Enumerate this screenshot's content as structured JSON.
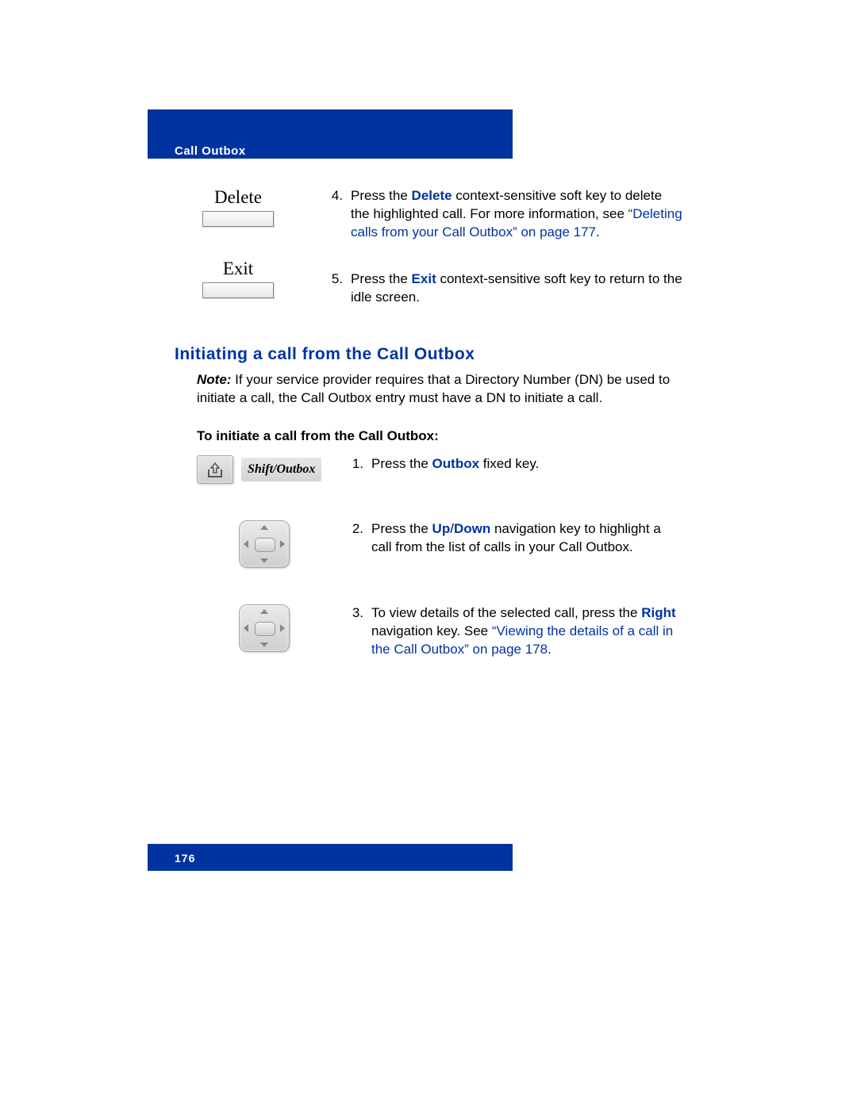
{
  "header": {
    "section": "Call Outbox"
  },
  "softkeys": {
    "delete": "Delete",
    "exit": "Exit"
  },
  "top_steps": {
    "s4": {
      "num": "4.",
      "t1": "Press the ",
      "bold": "Delete",
      "t2": " context-sensitive soft key to delete the highlighted call. For more information, see ",
      "link": "“Deleting calls from your Call Outbox” on page 177",
      "t3": "."
    },
    "s5": {
      "num": "5.",
      "t1": "Press the ",
      "bold": "Exit",
      "t2": " context-sensitive soft key to return to the idle screen."
    }
  },
  "heading": "Initiating a call from the Call Outbox",
  "note": {
    "label": "Note:",
    "body": "  If your service provider requires that a Directory Number (DN) be used to initiate a call, the Call Outbox entry must have a DN to initiate a call."
  },
  "subhead": "To initiate a call from the Call Outbox:",
  "proc": {
    "shift_label": "Shift/Outbox",
    "s1": {
      "num": "1.",
      "t1": "Press the ",
      "bold": "Outbox",
      "t2": " fixed key."
    },
    "s2": {
      "num": "2.",
      "t1": "Press the ",
      "bold_a": "Up",
      "slash": "/",
      "bold_b": "Down",
      "t2": " navigation key to highlight a call from the list of calls in your Call Outbox."
    },
    "s3": {
      "num": "3.",
      "t1": "To view details of the selected call, press the ",
      "bold": "Right",
      "t2": " navigation key. See ",
      "link": "“Viewing the details of a call in the Call Outbox” on page 178",
      "t3": "."
    }
  },
  "footer": {
    "page": "176"
  }
}
